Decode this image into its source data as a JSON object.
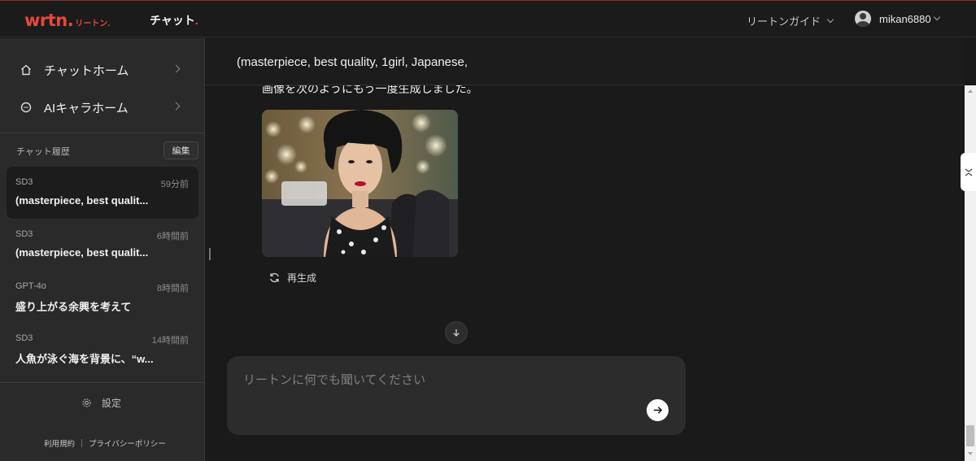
{
  "header": {
    "logo_main": "wrtn.",
    "logo_sub": "リートン.",
    "chat_label": "チャット",
    "chat_dot": ".",
    "guide_label": "リートンガイド",
    "username": "mikan6880"
  },
  "sidebar": {
    "nav": [
      {
        "label": "チャットホーム",
        "icon": "home-icon"
      },
      {
        "label": "AIキャラホーム",
        "icon": "chat-bubble-icon"
      }
    ],
    "history_title": "チャット履歴",
    "edit_label": "編集",
    "history": [
      {
        "model": "SD3",
        "time": "59分前",
        "title": "(masterpiece, best qualit..."
      },
      {
        "model": "SD3",
        "time": "6時間前",
        "title": "(masterpiece, best qualit..."
      },
      {
        "model": "GPT-4o",
        "time": "8時間前",
        "title": "盛り上がる余興を考えて"
      },
      {
        "model": "SD3",
        "time": "14時間前",
        "title": "人魚が泳ぐ海を背景に、“w..."
      }
    ],
    "settings_label": "設定",
    "terms_label": "利用規約",
    "privacy_label": "プライバシーポリシー"
  },
  "chat": {
    "title": "(masterpiece, best quality, 1girl, Japanese,",
    "message": "画像を次のようにもう一度生成しました。",
    "regenerate_label": "再生成",
    "input_placeholder": "リートンに何でも聞いてください"
  },
  "colors": {
    "brand": "#e8483a",
    "background": "#1a1a1a",
    "sidebar": "#2a2a2a"
  }
}
